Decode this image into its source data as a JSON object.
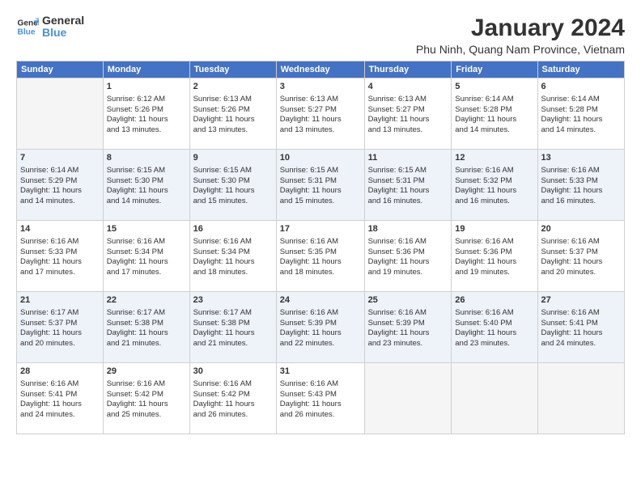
{
  "logo": {
    "line1": "General",
    "line2": "Blue"
  },
  "title": "January 2024",
  "subtitle": "Phu Ninh, Quang Nam Province, Vietnam",
  "header_days": [
    "Sunday",
    "Monday",
    "Tuesday",
    "Wednesday",
    "Thursday",
    "Friday",
    "Saturday"
  ],
  "weeks": [
    [
      {
        "day": "",
        "info": ""
      },
      {
        "day": "1",
        "info": "Sunrise: 6:12 AM\nSunset: 5:26 PM\nDaylight: 11 hours\nand 13 minutes."
      },
      {
        "day": "2",
        "info": "Sunrise: 6:13 AM\nSunset: 5:26 PM\nDaylight: 11 hours\nand 13 minutes."
      },
      {
        "day": "3",
        "info": "Sunrise: 6:13 AM\nSunset: 5:27 PM\nDaylight: 11 hours\nand 13 minutes."
      },
      {
        "day": "4",
        "info": "Sunrise: 6:13 AM\nSunset: 5:27 PM\nDaylight: 11 hours\nand 13 minutes."
      },
      {
        "day": "5",
        "info": "Sunrise: 6:14 AM\nSunset: 5:28 PM\nDaylight: 11 hours\nand 14 minutes."
      },
      {
        "day": "6",
        "info": "Sunrise: 6:14 AM\nSunset: 5:28 PM\nDaylight: 11 hours\nand 14 minutes."
      }
    ],
    [
      {
        "day": "7",
        "info": "Sunrise: 6:14 AM\nSunset: 5:29 PM\nDaylight: 11 hours\nand 14 minutes."
      },
      {
        "day": "8",
        "info": "Sunrise: 6:15 AM\nSunset: 5:30 PM\nDaylight: 11 hours\nand 14 minutes."
      },
      {
        "day": "9",
        "info": "Sunrise: 6:15 AM\nSunset: 5:30 PM\nDaylight: 11 hours\nand 15 minutes."
      },
      {
        "day": "10",
        "info": "Sunrise: 6:15 AM\nSunset: 5:31 PM\nDaylight: 11 hours\nand 15 minutes."
      },
      {
        "day": "11",
        "info": "Sunrise: 6:15 AM\nSunset: 5:31 PM\nDaylight: 11 hours\nand 16 minutes."
      },
      {
        "day": "12",
        "info": "Sunrise: 6:16 AM\nSunset: 5:32 PM\nDaylight: 11 hours\nand 16 minutes."
      },
      {
        "day": "13",
        "info": "Sunrise: 6:16 AM\nSunset: 5:33 PM\nDaylight: 11 hours\nand 16 minutes."
      }
    ],
    [
      {
        "day": "14",
        "info": "Sunrise: 6:16 AM\nSunset: 5:33 PM\nDaylight: 11 hours\nand 17 minutes."
      },
      {
        "day": "15",
        "info": "Sunrise: 6:16 AM\nSunset: 5:34 PM\nDaylight: 11 hours\nand 17 minutes."
      },
      {
        "day": "16",
        "info": "Sunrise: 6:16 AM\nSunset: 5:34 PM\nDaylight: 11 hours\nand 18 minutes."
      },
      {
        "day": "17",
        "info": "Sunrise: 6:16 AM\nSunset: 5:35 PM\nDaylight: 11 hours\nand 18 minutes."
      },
      {
        "day": "18",
        "info": "Sunrise: 6:16 AM\nSunset: 5:36 PM\nDaylight: 11 hours\nand 19 minutes."
      },
      {
        "day": "19",
        "info": "Sunrise: 6:16 AM\nSunset: 5:36 PM\nDaylight: 11 hours\nand 19 minutes."
      },
      {
        "day": "20",
        "info": "Sunrise: 6:16 AM\nSunset: 5:37 PM\nDaylight: 11 hours\nand 20 minutes."
      }
    ],
    [
      {
        "day": "21",
        "info": "Sunrise: 6:17 AM\nSunset: 5:37 PM\nDaylight: 11 hours\nand 20 minutes."
      },
      {
        "day": "22",
        "info": "Sunrise: 6:17 AM\nSunset: 5:38 PM\nDaylight: 11 hours\nand 21 minutes."
      },
      {
        "day": "23",
        "info": "Sunrise: 6:17 AM\nSunset: 5:38 PM\nDaylight: 11 hours\nand 21 minutes."
      },
      {
        "day": "24",
        "info": "Sunrise: 6:16 AM\nSunset: 5:39 PM\nDaylight: 11 hours\nand 22 minutes."
      },
      {
        "day": "25",
        "info": "Sunrise: 6:16 AM\nSunset: 5:39 PM\nDaylight: 11 hours\nand 23 minutes."
      },
      {
        "day": "26",
        "info": "Sunrise: 6:16 AM\nSunset: 5:40 PM\nDaylight: 11 hours\nand 23 minutes."
      },
      {
        "day": "27",
        "info": "Sunrise: 6:16 AM\nSunset: 5:41 PM\nDaylight: 11 hours\nand 24 minutes."
      }
    ],
    [
      {
        "day": "28",
        "info": "Sunrise: 6:16 AM\nSunset: 5:41 PM\nDaylight: 11 hours\nand 24 minutes."
      },
      {
        "day": "29",
        "info": "Sunrise: 6:16 AM\nSunset: 5:42 PM\nDaylight: 11 hours\nand 25 minutes."
      },
      {
        "day": "30",
        "info": "Sunrise: 6:16 AM\nSunset: 5:42 PM\nDaylight: 11 hours\nand 26 minutes."
      },
      {
        "day": "31",
        "info": "Sunrise: 6:16 AM\nSunset: 5:43 PM\nDaylight: 11 hours\nand 26 minutes."
      },
      {
        "day": "",
        "info": ""
      },
      {
        "day": "",
        "info": ""
      },
      {
        "day": "",
        "info": ""
      }
    ]
  ]
}
